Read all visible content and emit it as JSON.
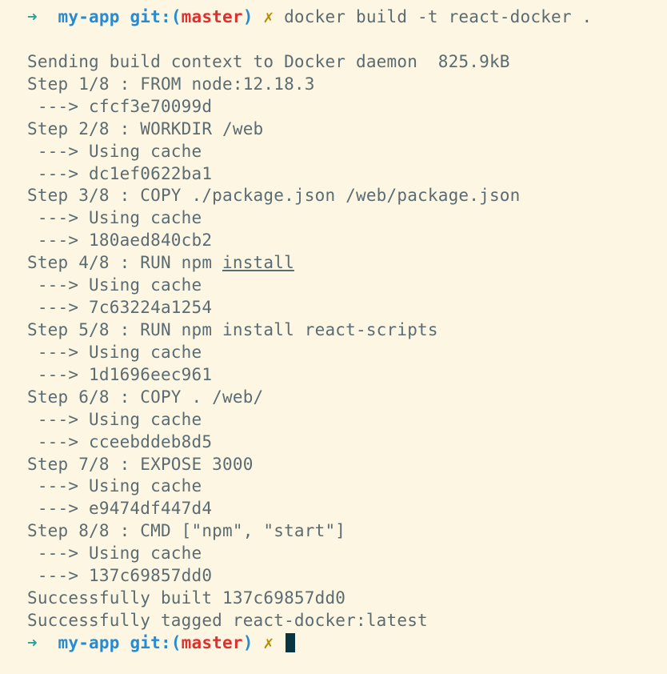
{
  "prompt1": {
    "arrow": "➜",
    "dir": "my-app",
    "git_label": "git:",
    "paren_open": "(",
    "branch": "master",
    "paren_close": ")",
    "dirty": "✗",
    "command": "docker build -t react-docker ."
  },
  "output": {
    "l0": "Sending build context to Docker daemon  825.9kB",
    "l1": "Step 1/8 : FROM node:12.18.3",
    "l2": " ---> cfcf3e70099d",
    "l3": "Step 2/8 : WORKDIR /web",
    "l4": " ---> Using cache",
    "l5": " ---> dc1ef0622ba1",
    "l6": "Step 3/8 : COPY ./package.json /web/package.json",
    "l7": " ---> Using cache",
    "l8": " ---> 180aed840cb2",
    "l9a": "Step 4/8 : RUN npm ",
    "l9b": "install",
    "l10": " ---> Using cache",
    "l11": " ---> 7c63224a1254",
    "l12": "Step 5/8 : RUN npm install react-scripts",
    "l13": " ---> Using cache",
    "l14": " ---> 1d1696eec961",
    "l15": "Step 6/8 : COPY . /web/",
    "l16": " ---> Using cache",
    "l17": " ---> cceebddeb8d5",
    "l18": "Step 7/8 : EXPOSE 3000",
    "l19": " ---> Using cache",
    "l20": " ---> e9474df447d4",
    "l21": "Step 8/8 : CMD [\"npm\", \"start\"]",
    "l22": " ---> Using cache",
    "l23": " ---> 137c69857dd0",
    "l24": "Successfully built 137c69857dd0",
    "l25": "Successfully tagged react-docker:latest"
  },
  "prompt2": {
    "arrow": "➜",
    "dir": "my-app",
    "git_label": "git:",
    "paren_open": "(",
    "branch": "master",
    "paren_close": ")",
    "dirty": "✗"
  }
}
